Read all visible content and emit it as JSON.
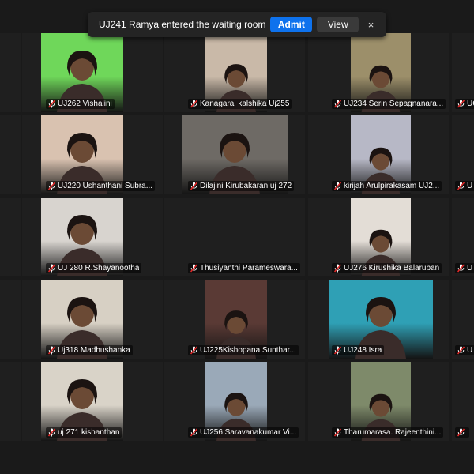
{
  "notification": {
    "message": "UJ241 Ramya entered the waiting room",
    "admit_label": "Admit",
    "view_label": "View",
    "close_glyph": "×"
  },
  "muted_icon": "muted-mic-icon",
  "colors": {
    "tile_bg": "#1f1f1f",
    "muted": "#e02828",
    "admit": "#0e72ed"
  },
  "participants": [
    {
      "name": "UJ262 Vishalini",
      "bg": "#6fd75a"
    },
    {
      "name": "Kanagaraj kalshika Uj255",
      "bg": "#c9b9a8"
    },
    {
      "name": "UJ234 Serin Sepagnanara...",
      "bg": "#9c8f6a"
    },
    {
      "name": "UC",
      "bg": ""
    },
    {
      "name": "UJ220 Ushanthani Subra...",
      "bg": "#d9c2b0"
    },
    {
      "name": "Dilajini Kirubakaran uj 272",
      "bg": "#6e6a65"
    },
    {
      "name": "kirijah Arulpirakasam UJ2...",
      "bg": "#b7b8c6"
    },
    {
      "name": "U",
      "bg": ""
    },
    {
      "name": "UJ 280 R.Shayanootha",
      "bg": "#d8d4cf"
    },
    {
      "name": "Thusiyanthi Parameswara...",
      "bg": ""
    },
    {
      "name": "UJ276  Kirushika Balaruban",
      "bg": "#e3ddd6"
    },
    {
      "name": "U",
      "bg": ""
    },
    {
      "name": "Uj318 Madhushanka",
      "bg": "#d7d0c4"
    },
    {
      "name": "UJ225Kishopana Sunthar...",
      "bg": "#5a3a35"
    },
    {
      "name": "UJ248 Isra",
      "bg": "#2fa0b5"
    },
    {
      "name": "U",
      "bg": ""
    },
    {
      "name": "uj 271 kishanthan",
      "bg": "#d9d3c8"
    },
    {
      "name": "UJ256 Saravanakumar Vi...",
      "bg": "#9aa9b8"
    },
    {
      "name": "Tharumarasa. Rajeenthini...",
      "bg": "#7e8a6a"
    },
    {
      "name": "",
      "bg": ""
    }
  ]
}
